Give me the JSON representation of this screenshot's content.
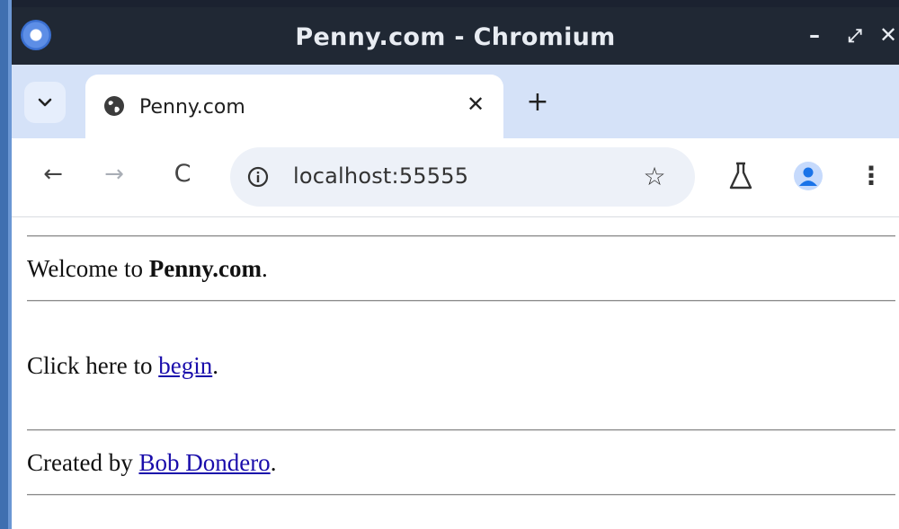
{
  "window": {
    "title": "Penny.com - Chromium",
    "controls": {
      "minimize": "–",
      "maximize": "⤢",
      "close": "✕"
    }
  },
  "tabs": {
    "search_icon": "chevron-down-icon",
    "active_tab": {
      "title": "Penny.com",
      "icon": "globe-icon",
      "close": "✕"
    },
    "new_tab": "+"
  },
  "toolbar": {
    "back": "←",
    "forward": "→",
    "reload": "C",
    "url": "localhost:55555",
    "bookmark": "☆",
    "menu": "⋮"
  },
  "page": {
    "welcome_prefix": "Welcome to ",
    "welcome_brand": "Penny.com",
    "welcome_suffix": ".",
    "click_prefix": "Click here to ",
    "click_link": "begin",
    "click_suffix": ".",
    "created_prefix": "Created by ",
    "created_link": "Bob Dondero",
    "created_suffix": "."
  },
  "colors": {
    "titlebar": "#202834",
    "tabstrip": "#d5e2f8",
    "link": "#1a0dab",
    "profile_accent": "#1a73e8"
  }
}
